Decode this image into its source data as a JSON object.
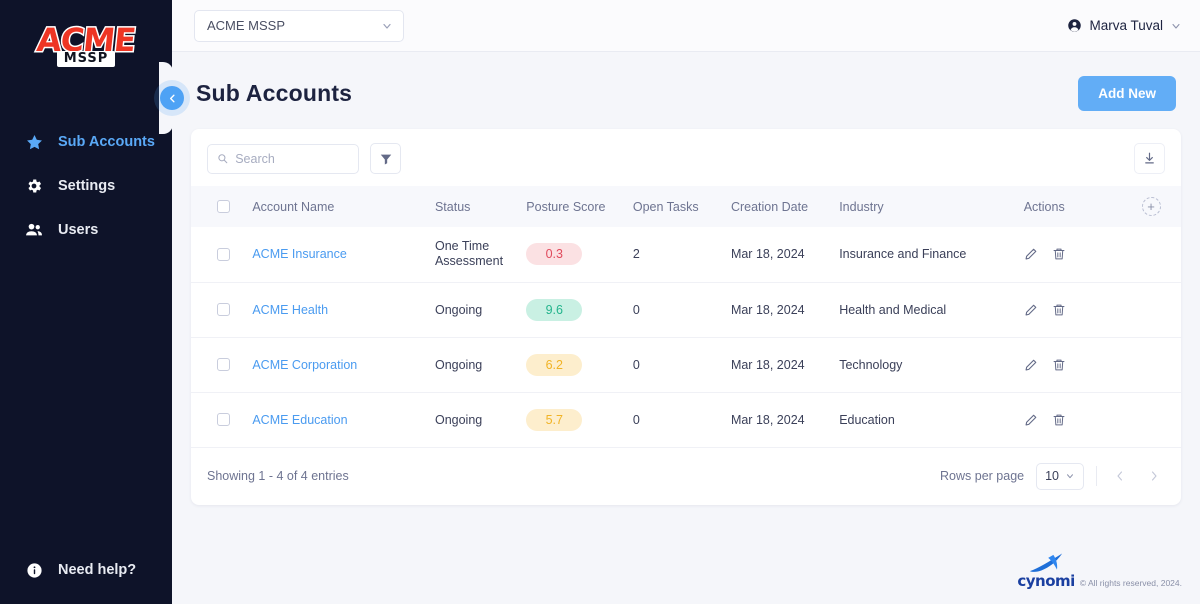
{
  "sidebar": {
    "logo": {
      "primary": "ACME",
      "secondary": "MSSP"
    },
    "items": [
      {
        "label": "Sub Accounts",
        "icon": "star-icon",
        "active": true
      },
      {
        "label": "Settings",
        "icon": "gear-icon",
        "active": false
      },
      {
        "label": "Users",
        "icon": "users-icon",
        "active": false
      }
    ],
    "help": {
      "label": "Need help?",
      "icon": "info-icon"
    },
    "collapse": {
      "icon": "chevron-left-icon"
    }
  },
  "topbar": {
    "org_select": {
      "value": "ACME MSSP",
      "icon": "chevron-down-icon"
    },
    "user": {
      "name": "Marva Tuval",
      "avatar_icon": "user-circle-icon",
      "chevron": "chevron-down-icon"
    }
  },
  "page": {
    "title": "Sub Accounts",
    "add_new_label": "Add New"
  },
  "toolbar": {
    "search": {
      "placeholder": "Search",
      "value": "",
      "icon": "search-icon"
    },
    "filter_icon": "filter-funnel-icon",
    "download_icon": "download-icon"
  },
  "table": {
    "columns": [
      "Account Name",
      "Status",
      "Posture Score",
      "Open Tasks",
      "Creation Date",
      "Industry",
      "Actions"
    ],
    "add_column_icon": "plus-icon",
    "rows": [
      {
        "account_name": "ACME Insurance",
        "status": "One Time Assessment",
        "posture_score": "0.3",
        "score_tone": "red",
        "open_tasks": "2",
        "creation_date": "Mar 18, 2024",
        "industry": "Insurance and Finance"
      },
      {
        "account_name": "ACME Health",
        "status": "Ongoing",
        "posture_score": "9.6",
        "score_tone": "green",
        "open_tasks": "0",
        "creation_date": "Mar 18, 2024",
        "industry": "Health and Medical"
      },
      {
        "account_name": "ACME Corporation",
        "status": "Ongoing",
        "posture_score": "6.2",
        "score_tone": "amber",
        "open_tasks": "0",
        "creation_date": "Mar 18, 2024",
        "industry": "Technology"
      },
      {
        "account_name": "ACME Education",
        "status": "Ongoing",
        "posture_score": "5.7",
        "score_tone": "amber",
        "open_tasks": "0",
        "creation_date": "Mar 18, 2024",
        "industry": "Education"
      }
    ],
    "row_actions": {
      "edit_icon": "pencil-icon",
      "delete_icon": "trash-icon"
    }
  },
  "footer": {
    "showing_text": "Showing 1 - 4 of 4 entries",
    "rows_per_page_label": "Rows per page",
    "rows_per_page_value": "10",
    "prev_icon": "chevron-left-icon",
    "next_icon": "chevron-right-icon"
  },
  "brand": {
    "name": "cynomi",
    "copyright": "© All rights reserved, 2024."
  },
  "colors": {
    "sidebar_bg": "#0e1329",
    "accent_blue": "#62adf6",
    "link_blue": "#4a9bf0",
    "score_red": "#e04a5c",
    "score_green": "#23b48c",
    "score_amber": "#f1b325"
  }
}
